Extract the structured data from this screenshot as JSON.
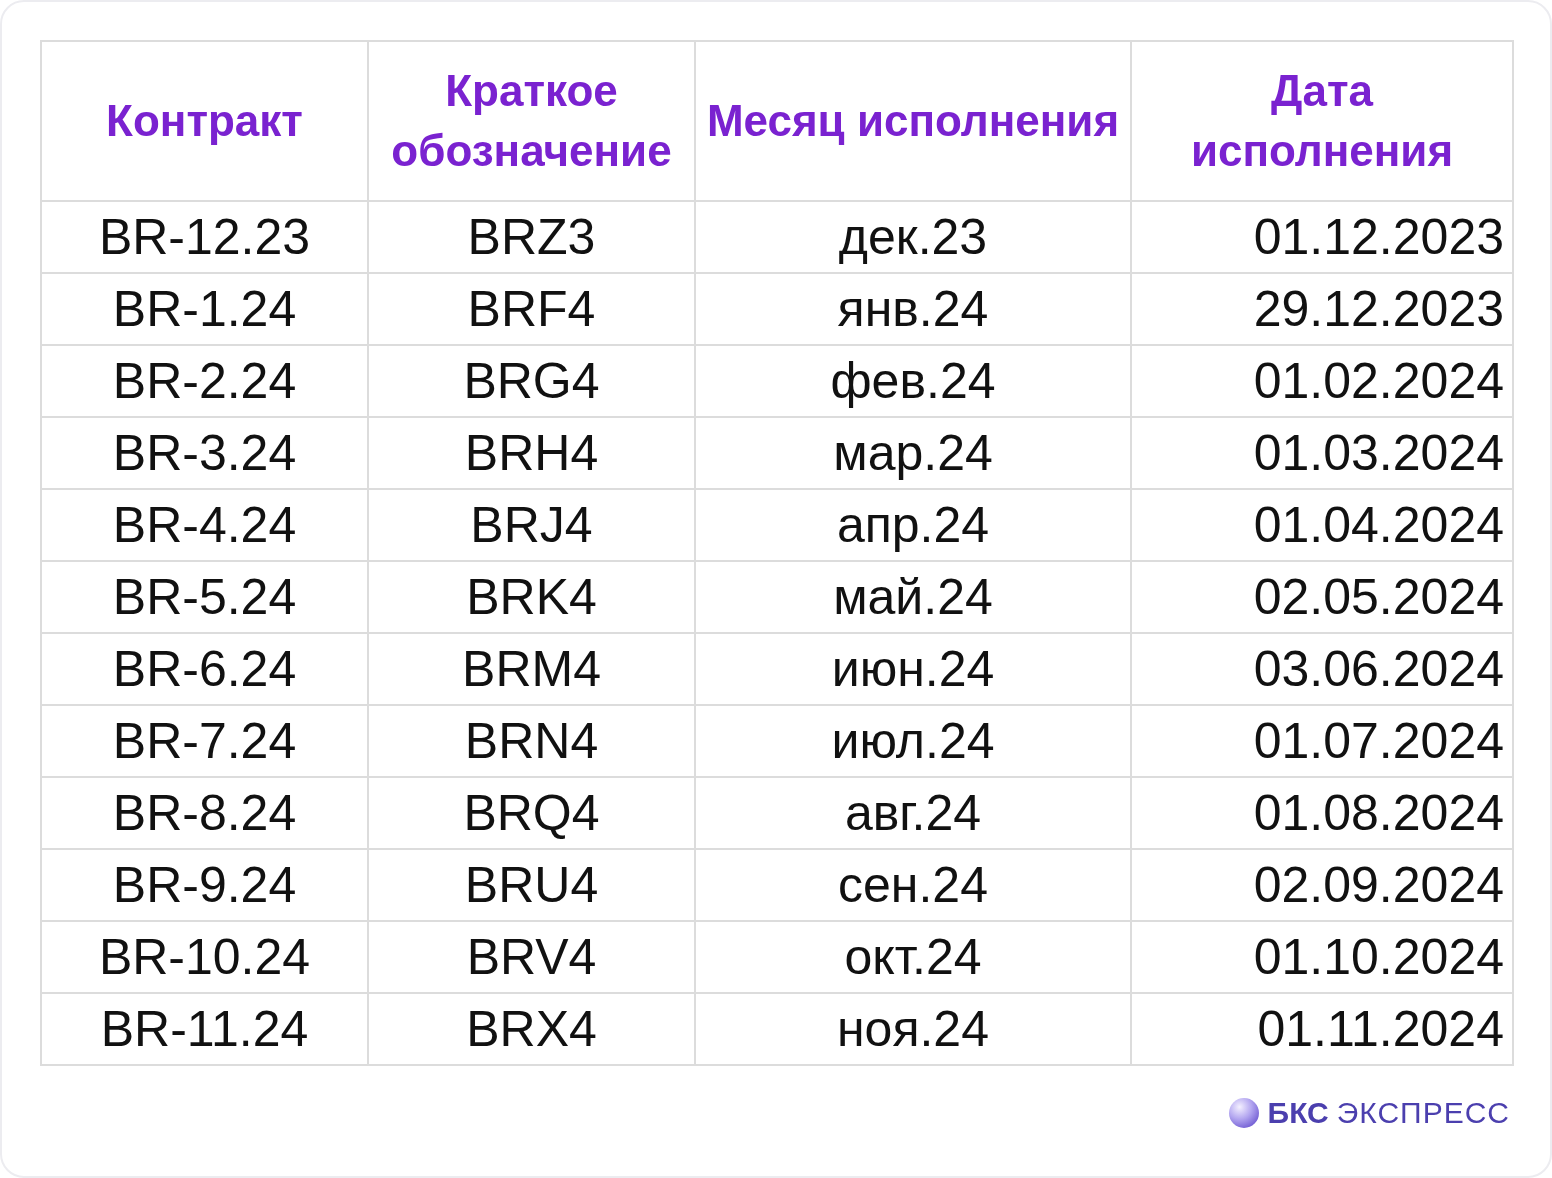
{
  "table": {
    "columns": [
      "Контракт",
      "Краткое обозначение",
      "Месяц исполнения",
      "Дата исполнения"
    ],
    "rows": [
      [
        "BR-12.23",
        "BRZ3",
        "дек.23",
        "01.12.2023"
      ],
      [
        "BR-1.24",
        "BRF4",
        "янв.24",
        "29.12.2023"
      ],
      [
        "BR-2.24",
        "BRG4",
        "фев.24",
        "01.02.2024"
      ],
      [
        "BR-3.24",
        "BRH4",
        "мар.24",
        "01.03.2024"
      ],
      [
        "BR-4.24",
        "BRJ4",
        "апр.24",
        "01.04.2024"
      ],
      [
        "BR-5.24",
        "BRK4",
        "май.24",
        "02.05.2024"
      ],
      [
        "BR-6.24",
        "BRM4",
        "июн.24",
        "03.06.2024"
      ],
      [
        "BR-7.24",
        "BRN4",
        "июл.24",
        "01.07.2024"
      ],
      [
        "BR-8.24",
        "BRQ4",
        "авг.24",
        "01.08.2024"
      ],
      [
        "BR-9.24",
        "BRU4",
        "сен.24",
        "02.09.2024"
      ],
      [
        "BR-10.24",
        "BRV4",
        "окт.24",
        "01.10.2024"
      ],
      [
        "BR-11.24",
        "BRX4",
        "ноя.24",
        "01.11.2024"
      ]
    ]
  },
  "logo": {
    "brand": "БКС",
    "name": "ЭКСПРЕСС"
  }
}
